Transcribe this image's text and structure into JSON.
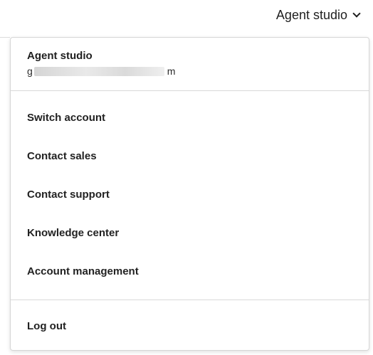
{
  "header": {
    "account_label": "Agent studio",
    "dropdown_icon": "chevron-down-icon"
  },
  "menu": {
    "account_name": "Agent studio",
    "email_prefix": "g",
    "email_suffix": "m",
    "items": [
      {
        "label": "Switch account"
      },
      {
        "label": "Contact sales"
      },
      {
        "label": "Contact support"
      },
      {
        "label": "Knowledge center"
      },
      {
        "label": "Account management"
      }
    ],
    "logout_label": "Log out"
  }
}
